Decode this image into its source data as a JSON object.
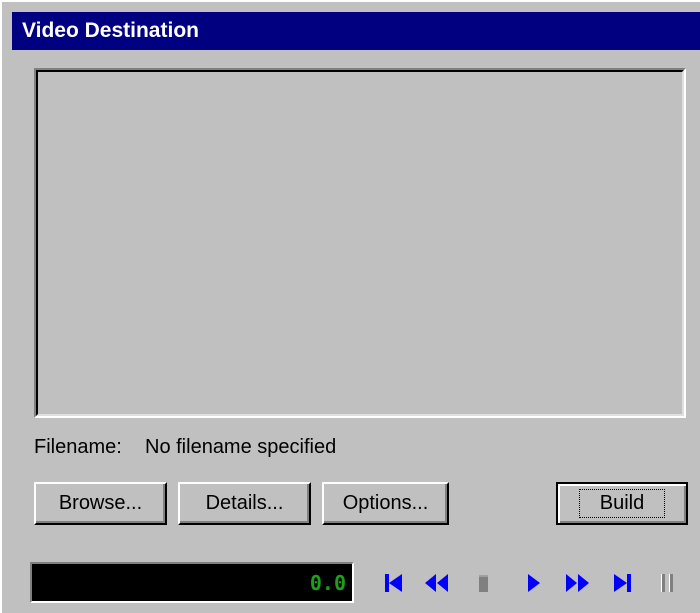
{
  "window": {
    "title": "Video Destination"
  },
  "preview": {
    "label": ""
  },
  "file": {
    "label": "Filename:",
    "value": "No filename specified"
  },
  "buttons": {
    "browse": "Browse...",
    "details": "Details...",
    "options": "Options...",
    "build": "Build"
  },
  "counter": {
    "value": "0.0"
  },
  "transport": {
    "icons": [
      "skip-to-start-icon",
      "rewind-icon",
      "stop-icon",
      "play-icon",
      "fast-forward-icon",
      "skip-to-end-icon",
      "pause-icon"
    ],
    "active_color": "#0000ff",
    "disabled_color": "#808080"
  },
  "colors": {
    "title_bar": "#000080",
    "counter_text": "#1aa01a",
    "face": "#c0c0c0"
  }
}
